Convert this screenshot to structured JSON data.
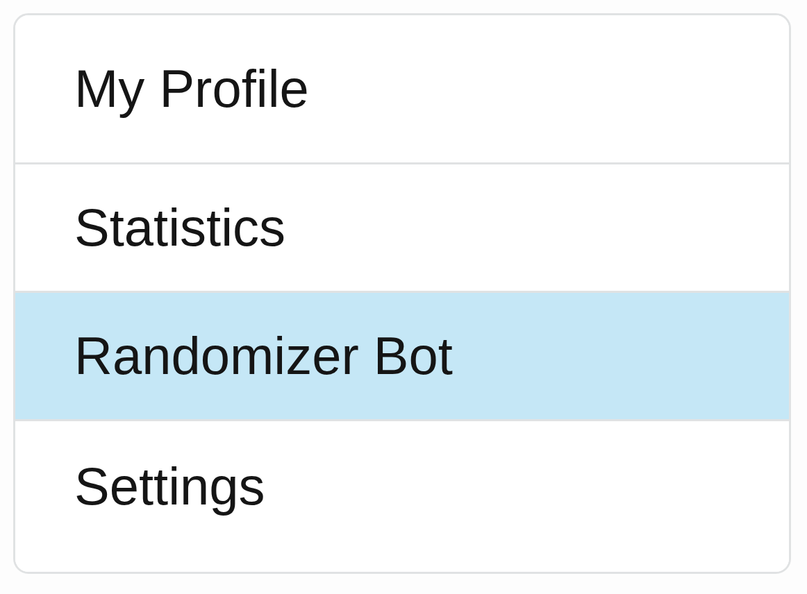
{
  "menu": {
    "items": [
      {
        "label": "My Profile",
        "selected": false
      },
      {
        "label": "Statistics",
        "selected": false
      },
      {
        "label": "Randomizer Bot",
        "selected": true
      },
      {
        "label": "Settings",
        "selected": false
      }
    ]
  }
}
